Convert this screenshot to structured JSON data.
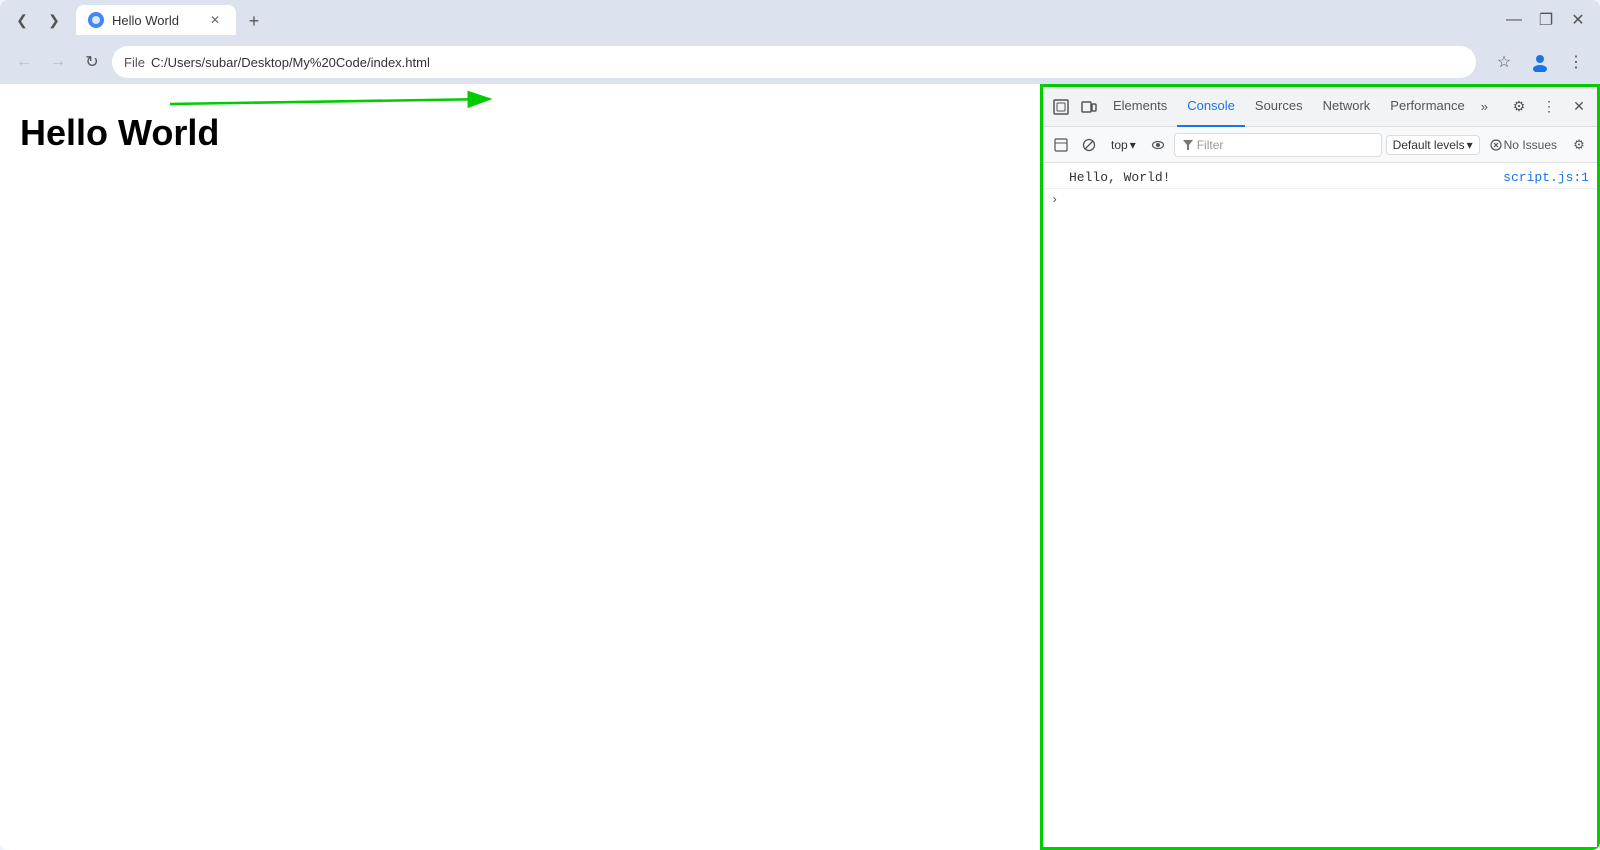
{
  "browser": {
    "tab": {
      "title": "Hello World",
      "favicon": "🌐"
    },
    "address": {
      "file_label": "File",
      "url": "C:/Users/subar/Desktop/My%20Code/index.html"
    },
    "window_controls": {
      "minimize": "—",
      "maximize": "❐",
      "close": "✕"
    }
  },
  "page": {
    "heading": "Hello World"
  },
  "devtools": {
    "tabs": [
      {
        "id": "elements",
        "label": "Elements",
        "active": false
      },
      {
        "id": "console",
        "label": "Console",
        "active": true
      },
      {
        "id": "sources",
        "label": "Sources",
        "active": false
      },
      {
        "id": "network",
        "label": "Network",
        "active": false
      },
      {
        "id": "performance",
        "label": "Performance",
        "active": false
      }
    ],
    "more_tabs": "»",
    "console": {
      "top_label": "top",
      "filter_placeholder": "Filter",
      "default_levels_label": "Default levels",
      "no_issues_label": "No Issues",
      "log_message": "Hello, World!",
      "log_source": "script.js:1"
    }
  },
  "icons": {
    "back": "←",
    "forward": "→",
    "refresh": "↻",
    "star": "☆",
    "profile": "👤",
    "more": "⋮",
    "select_element": "⬚",
    "device_mode": "⬜",
    "close": "✕",
    "settings": "⚙",
    "vertical_dots": "⋮",
    "ban": "⊘",
    "eye": "👁",
    "filter": "▼",
    "chevron_right": "›",
    "chevron_down": "▾"
  },
  "annotation": {
    "arrow_color": "#00cc00"
  }
}
